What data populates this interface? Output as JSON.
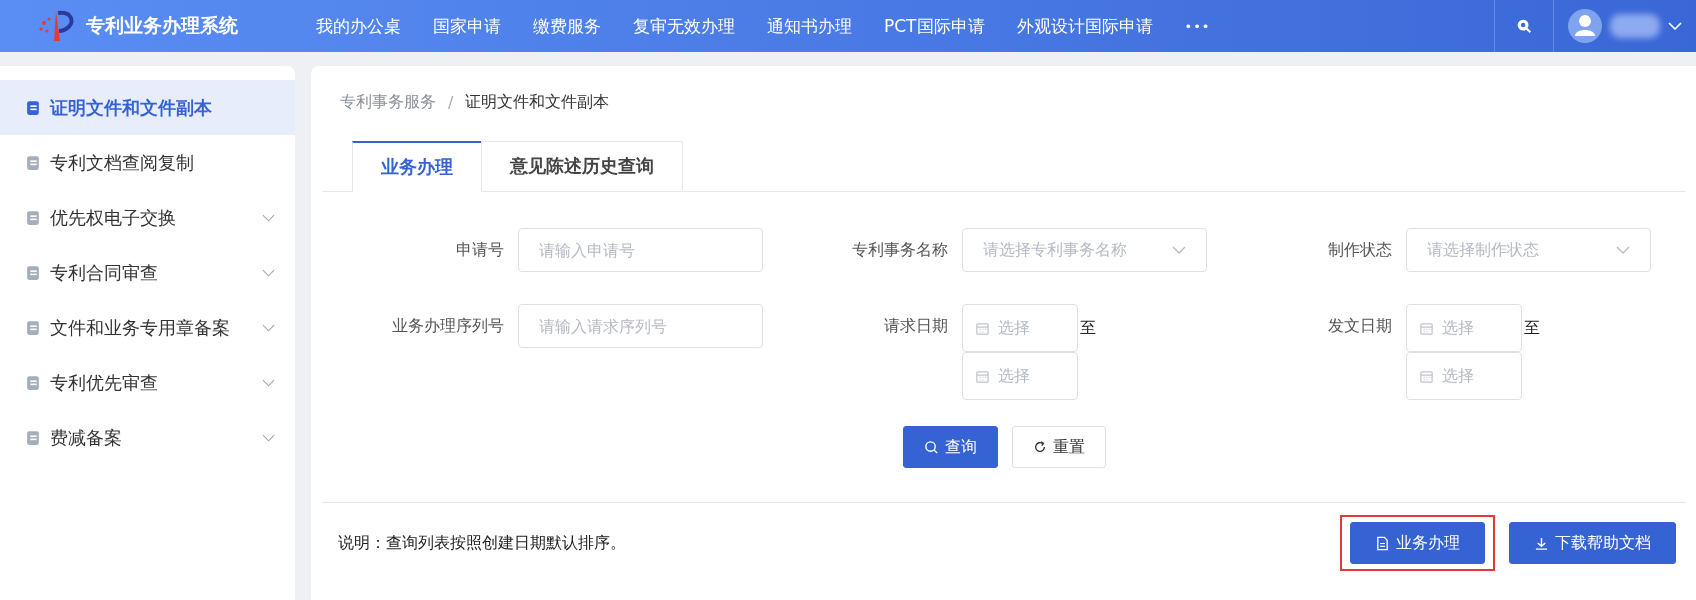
{
  "header": {
    "title": "专利业务办理系统",
    "nav": [
      {
        "label": "我的办公桌"
      },
      {
        "label": "国家申请"
      },
      {
        "label": "缴费服务"
      },
      {
        "label": "复审无效办理"
      },
      {
        "label": "通知书办理"
      },
      {
        "label": "PCT国际申请"
      },
      {
        "label": "外观设计国际申请"
      }
    ],
    "more": "•••"
  },
  "sidebar": {
    "items": [
      {
        "label": "证明文件和文件副本",
        "selected": true,
        "expandable": false
      },
      {
        "label": "专利文档查阅复制",
        "selected": false,
        "expandable": false
      },
      {
        "label": "优先权电子交换",
        "selected": false,
        "expandable": true
      },
      {
        "label": "专利合同审查",
        "selected": false,
        "expandable": true
      },
      {
        "label": "文件和业务专用章备案",
        "selected": false,
        "expandable": true
      },
      {
        "label": "专利优先审查",
        "selected": false,
        "expandable": true
      },
      {
        "label": "费减备案",
        "selected": false,
        "expandable": true
      }
    ]
  },
  "breadcrumb": {
    "separator": "/",
    "items": [
      "专利事务服务",
      "证明文件和文件副本"
    ]
  },
  "tabs": [
    {
      "label": "业务办理",
      "selected": true
    },
    {
      "label": "意见陈述历史查询",
      "selected": false
    }
  ],
  "form": {
    "fields": [
      {
        "kind": "input",
        "label": "申请号",
        "placeholder": "请输入申请号"
      },
      {
        "kind": "select",
        "label": "专利事务名称",
        "placeholder": "请选择专利事务名称"
      },
      {
        "kind": "select",
        "label": "制作状态",
        "placeholder": "请选择制作状态"
      },
      {
        "kind": "input",
        "label": "业务办理序列号",
        "placeholder": "请输入请求序列号"
      },
      {
        "kind": "daterange",
        "label": "请求日期",
        "start_placeholder": "选择",
        "end_placeholder": "选择",
        "separator": "至"
      },
      {
        "kind": "daterange",
        "label": "发文日期",
        "start_placeholder": "选择",
        "end_placeholder": "选择",
        "separator": "至"
      }
    ],
    "buttons": [
      {
        "label": "查询",
        "primary": true
      },
      {
        "label": "重置",
        "primary": false
      }
    ]
  },
  "footer": {
    "note": "说明：查询列表按照创建日期默认排序。",
    "buttons": [
      {
        "label": "业务办理",
        "highlighted": true
      },
      {
        "label": "下载帮助文档",
        "highlighted": false
      }
    ]
  }
}
